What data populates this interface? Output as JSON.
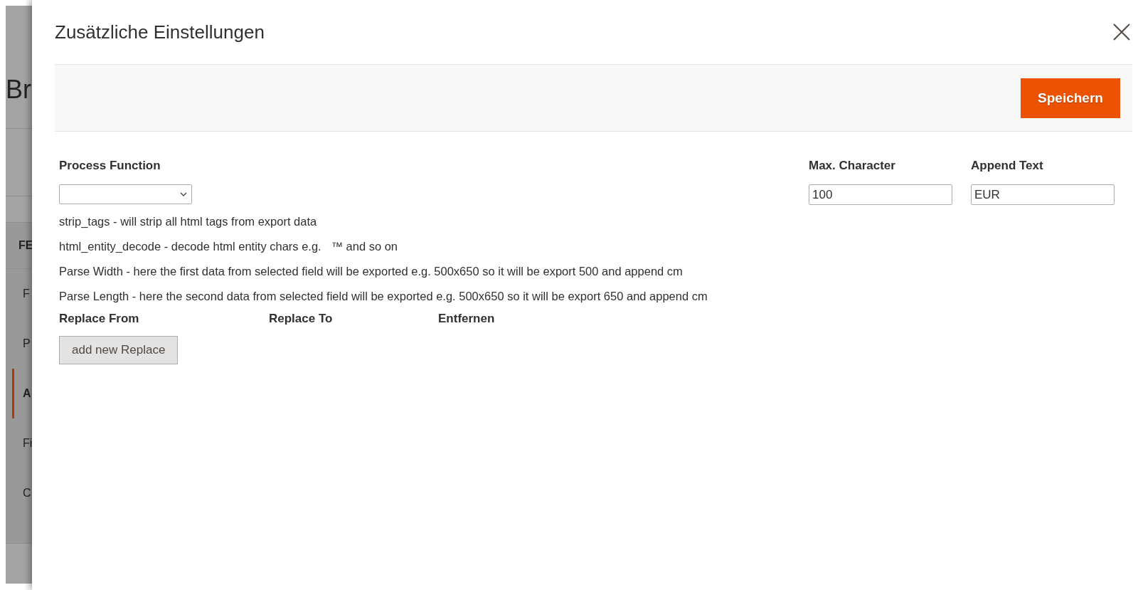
{
  "background_page": {
    "heading": "Br",
    "nav_title": "FE",
    "nav_items": [
      {
        "label": "F",
        "selected": false
      },
      {
        "label": "P",
        "selected": false
      },
      {
        "label": "A",
        "selected": true
      },
      {
        "label": "Fi",
        "selected": false
      },
      {
        "label": "C",
        "selected": false
      }
    ]
  },
  "modal": {
    "title": "Zusätzliche Einstellungen",
    "save_button": "Speichern",
    "process_function": {
      "label": "Process Function"
    },
    "max_character": {
      "label": "Max. Character",
      "value": "100"
    },
    "append_text": {
      "label": "Append Text",
      "value": "EUR"
    },
    "help_lines": [
      "strip_tags - will strip all html tags from export data",
      "html_entity_decode - decode html entity chars e.g.   ™ and so on",
      "Parse Width - here the first data from selected field will be exported e.g. 500x650 so it will be export 500 and append cm",
      "Parse Length - here the second data from selected field will be exported e.g. 500x650 so it will be export 650 and append cm"
    ],
    "replace_columns": [
      "Replace From",
      "Replace To",
      "Entfernen"
    ],
    "add_button": "add new Replace"
  }
}
